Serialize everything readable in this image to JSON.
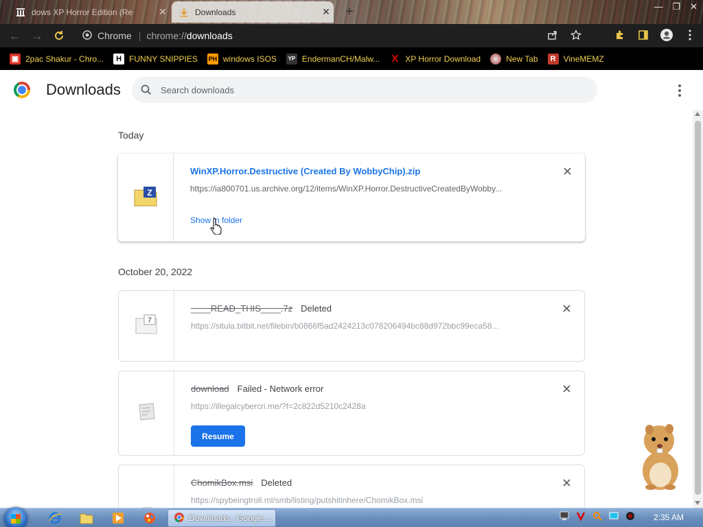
{
  "tabs": [
    {
      "title": "dows XP Horror Edition (Re",
      "active": false
    },
    {
      "title": "Downloads",
      "active": true
    }
  ],
  "omnibox": {
    "site": "Chrome",
    "url_prefix": "chrome://",
    "url_host": "downloads"
  },
  "bookmarks": [
    {
      "label": "2pac Shakur - Chro...",
      "icon": "red-box-icon",
      "color": "#d93025"
    },
    {
      "label": "FUNNY SNIPPIES",
      "icon": "letter-h-icon",
      "color": "#000000"
    },
    {
      "label": "windows ISOS",
      "icon": "ph-logo-icon",
      "color": "#ff9900"
    },
    {
      "label": "EndermanCH/Malw...",
      "icon": "yp-logo-icon",
      "color": "#333333"
    },
    {
      "label": "XP Horror Download",
      "icon": "red-x-icon",
      "color": "#e00000"
    },
    {
      "label": "New Tab",
      "icon": "globe-icon",
      "color": "#c0392b"
    },
    {
      "label": "VineMEMZ",
      "icon": "letter-r-icon",
      "color": "#c0392b"
    }
  ],
  "header": {
    "title": "Downloads",
    "search_placeholder": "Search downloads"
  },
  "groups": [
    {
      "date": "Today",
      "items": [
        {
          "name": "WinXP.Horror.Destructive (Created By WobbyChip).zip",
          "url": "https://ia800701.us.archive.org/12/items/WinXP.Horror.DestructiveCreatedByWobby...",
          "action": "Show in folder",
          "status": "",
          "icon": "zip-folder-icon"
        }
      ]
    },
    {
      "date": "October 20, 2022",
      "items": [
        {
          "name": "____READ_THIS____.7z",
          "status": "Deleted",
          "url": "https://situla.bitbit.net/filebin/b0866f5ad2424213c078206494bc88d972bbc99eca58...",
          "icon": "7z-file-icon"
        },
        {
          "name": "download",
          "status": "Failed - Network error",
          "url": "https://illegalcybercri.me/?f=2c822d5210c2428a",
          "action": "Resume",
          "icon": "broken-file-icon"
        },
        {
          "name": "ChomikBox.msi",
          "status": "Deleted",
          "url": "https://spybeingtroll.ml/smb/listing/putshitinhere/ChomikBox.msi",
          "icon": "installer-icon"
        }
      ]
    }
  ],
  "taskbar": {
    "task_label": "Downloads - Google ...",
    "clock": "2:35 AM"
  },
  "colors": {
    "accent": "#1a73e8",
    "toolbar": "#1f1f1f",
    "bookmarks_text": "#f0d050"
  }
}
